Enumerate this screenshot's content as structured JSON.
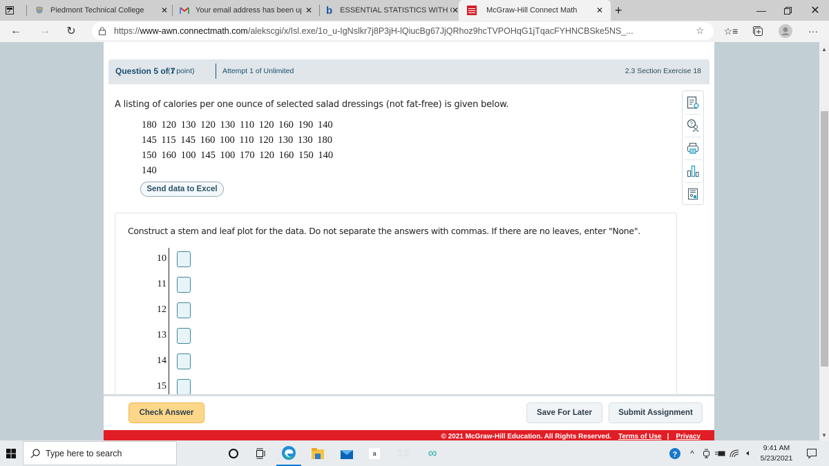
{
  "browser": {
    "tabs": [
      {
        "title": "Piedmont Technical College",
        "icon": "piedmont-favicon",
        "active": false
      },
      {
        "title": "Your email address has been upd",
        "icon": "gmail-icon",
        "active": false
      },
      {
        "title": "ESSENTIAL STATISTICS WITH CO",
        "icon": "bing-icon",
        "active": false
      },
      {
        "title": "McGraw-Hill Connect Math",
        "icon": "mcgraw-hill-icon",
        "active": true
      }
    ],
    "new_tab": "+",
    "url": {
      "prefix": "https://",
      "host": "www-awn.connectmath.com",
      "path": "/alekscgi/x/Isl.exe/1o_u-IgNslkr7j8P3jH-lQiucBg67JjQRhoz9hcTVPOHqG1jTqacFYHNCBSke5NS_..."
    }
  },
  "question": {
    "number_label": "Question 5 of 7",
    "points_label": "(1 point)",
    "attempt_label": "Attempt 1 of Unlimited",
    "section_label": "2.3 Section Exercise 18",
    "intro": "A listing of calories per one ounce of selected salad dressings (not fat-free) is given below.",
    "data_rows": [
      "180 120 130 120 130 110 120 160 190 140",
      "145 115 145 160 100 110 120 130 130 180",
      "150 160 100 145 100 170 120 160 150 140",
      "140"
    ],
    "excel_button": "Send data to Excel",
    "prompt": "Construct a stem and leaf plot for the data. Do not separate the answers with commas. If there are no leaves, enter \"None\".",
    "stems": [
      {
        "stem": "10",
        "leaf_value": ""
      },
      {
        "stem": "11",
        "leaf_value": ""
      },
      {
        "stem": "12",
        "leaf_value": ""
      },
      {
        "stem": "13",
        "leaf_value": ""
      },
      {
        "stem": "14",
        "leaf_value": ""
      },
      {
        "stem": "15",
        "leaf_value": ""
      }
    ]
  },
  "tools": [
    "guided-solution-icon",
    "ask-instructor-icon",
    "print-icon",
    "statistics-icon",
    "calculator-icon"
  ],
  "buttons": {
    "check_answer": "Check Answer",
    "save_for_later": "Save For Later",
    "submit_assignment": "Submit Assignment"
  },
  "footer": {
    "copyright": "© 2021 McGraw-Hill Education. All Rights Reserved.",
    "terms": "Terms of Use",
    "separator": "|",
    "privacy": "Privacy"
  },
  "taskbar": {
    "search_placeholder": "Type here to search",
    "time": "9:41 AM",
    "date": "5/23/2021"
  },
  "colors": {
    "page_bg": "#c2cfd5",
    "header_text": "#1a4f72",
    "check_answer_bg": "#fcd78a",
    "footer_red": "#e11e26",
    "leaf_input_border": "#3a8a9a"
  }
}
